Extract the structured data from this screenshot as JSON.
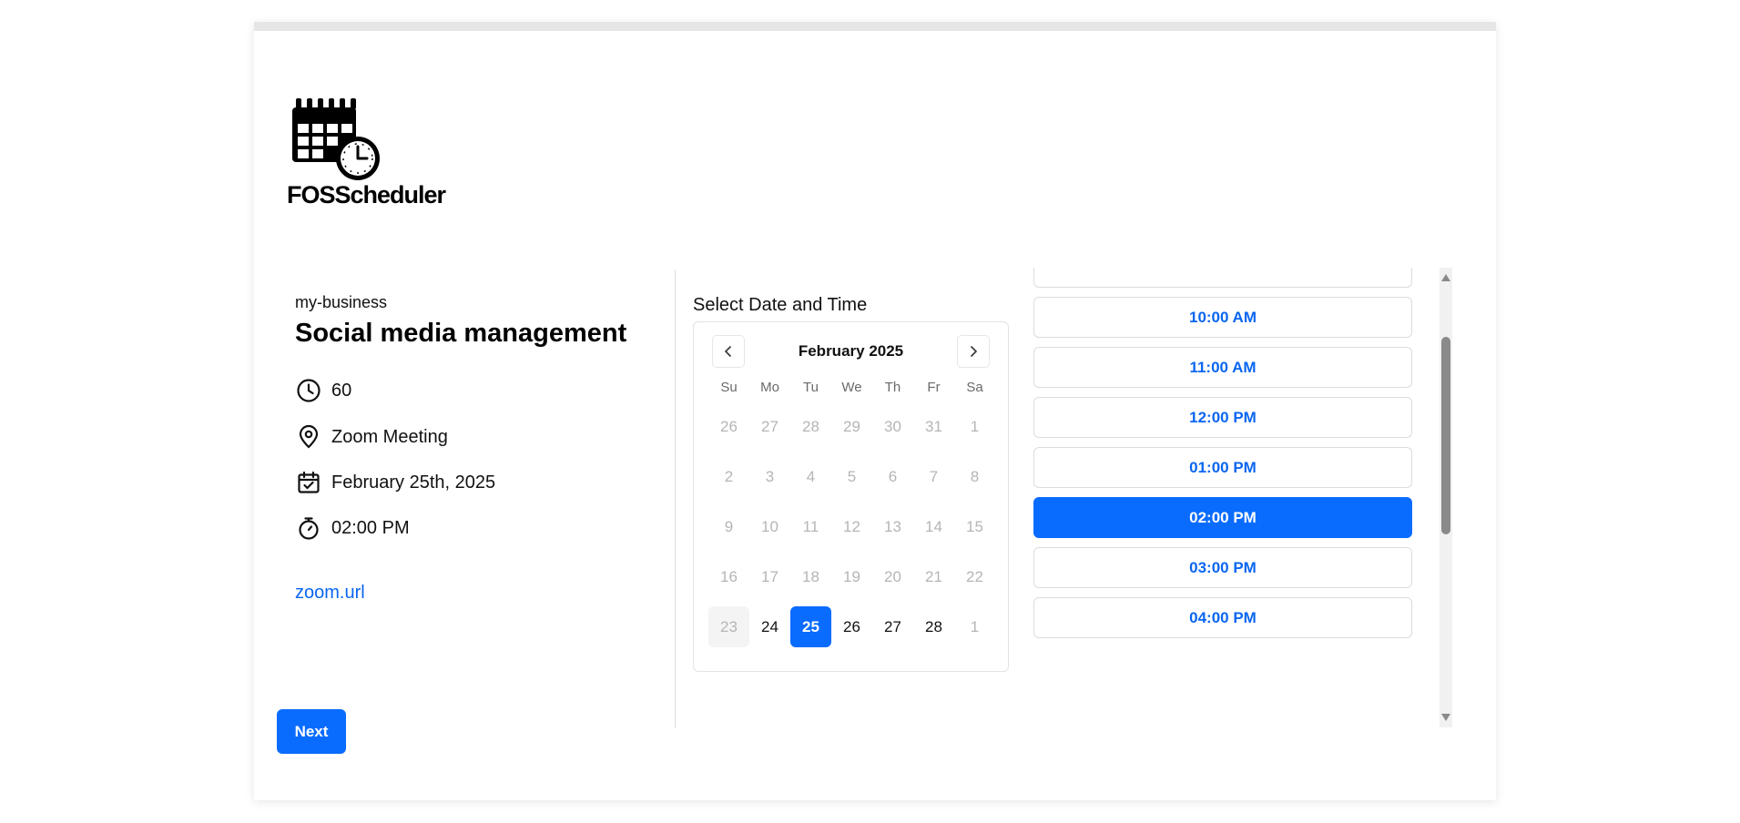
{
  "brand": {
    "logo_text": "FOSScheduler"
  },
  "event": {
    "business": "my-business",
    "title": "Social media management",
    "duration": "60",
    "location": "Zoom Meeting",
    "date": "February 25th, 2025",
    "time": "02:00 PM",
    "link": "zoom.url",
    "icons": [
      "clock-icon",
      "location-pin-icon",
      "calendar-check-icon",
      "stopwatch-icon"
    ]
  },
  "picker": {
    "label": "Select Date and Time",
    "month": "February 2025",
    "weekdays": [
      "Su",
      "Mo",
      "Tu",
      "We",
      "Th",
      "Fr",
      "Sa"
    ],
    "weeks": [
      [
        "26",
        "27",
        "28",
        "29",
        "30",
        "31",
        "1"
      ],
      [
        "2",
        "3",
        "4",
        "5",
        "6",
        "7",
        "8"
      ],
      [
        "9",
        "10",
        "11",
        "12",
        "13",
        "14",
        "15"
      ],
      [
        "16",
        "17",
        "18",
        "19",
        "20",
        "21",
        "22"
      ],
      [
        "23",
        "24",
        "25",
        "26",
        "27",
        "28",
        "1"
      ]
    ],
    "available_days": [
      "24",
      "25",
      "26",
      "27",
      "28"
    ],
    "today": "23",
    "selected_day": "25"
  },
  "slots": [
    "10:00 AM",
    "11:00 AM",
    "12:00 PM",
    "01:00 PM",
    "02:00 PM",
    "03:00 PM",
    "04:00 PM"
  ],
  "selected_slot": "02:00 PM",
  "actions": {
    "next_label": "Next"
  },
  "colors": {
    "accent": "#0a6cff",
    "link": "#0a66f0"
  }
}
